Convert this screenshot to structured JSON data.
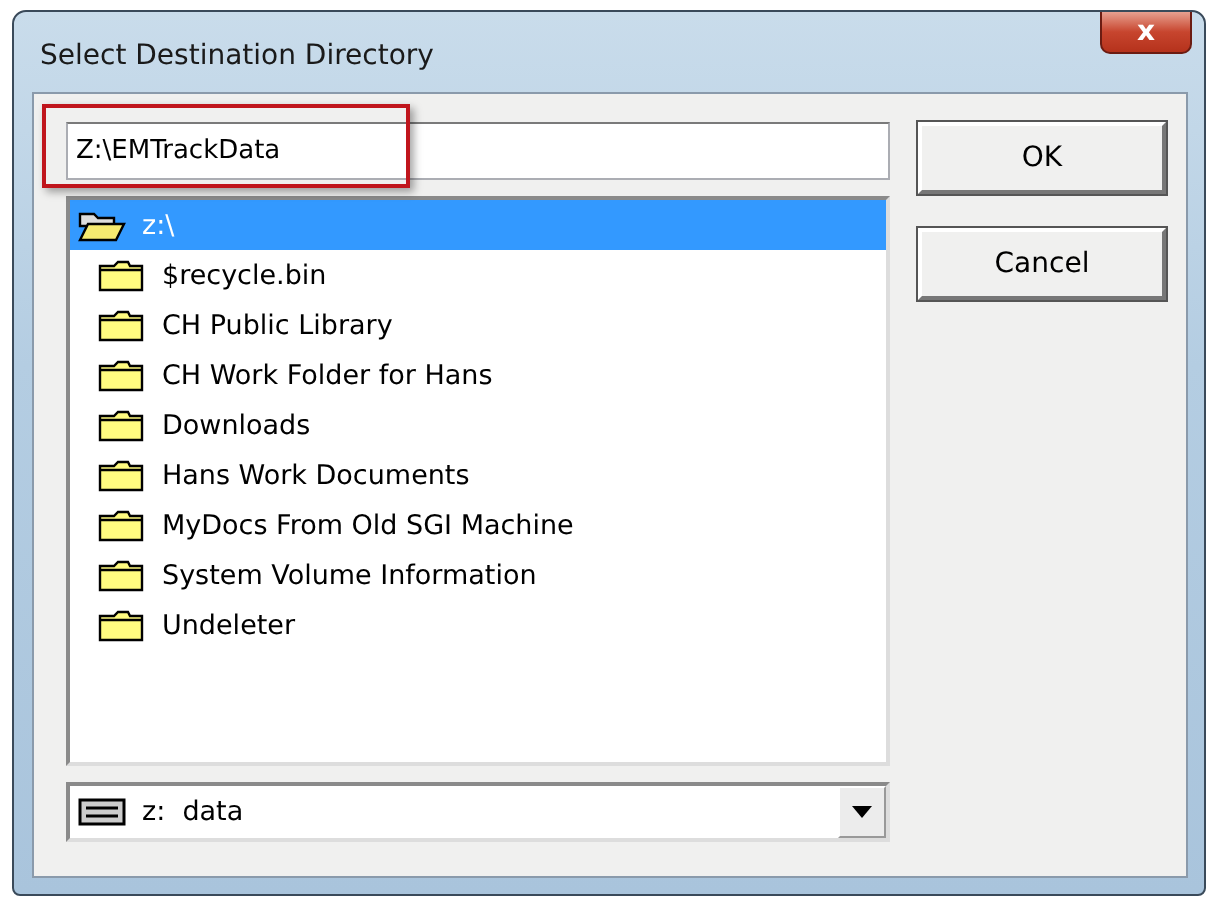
{
  "window": {
    "title": "Select Destination Directory",
    "close_label": "x"
  },
  "path_field": {
    "value": "Z:\\EMTrackData"
  },
  "buttons": [
    "OK",
    "Cancel"
  ],
  "folders": [
    {
      "name": "z:\\",
      "kind": "open",
      "selected": true
    },
    {
      "name": "$recycle.bin",
      "kind": "closed",
      "selected": false
    },
    {
      "name": "CH Public Library",
      "kind": "closed",
      "selected": false
    },
    {
      "name": "CH Work Folder for Hans",
      "kind": "closed",
      "selected": false
    },
    {
      "name": "Downloads",
      "kind": "closed",
      "selected": false
    },
    {
      "name": "Hans Work Documents",
      "kind": "closed",
      "selected": false
    },
    {
      "name": "MyDocs From Old SGI Machine",
      "kind": "closed",
      "selected": false
    },
    {
      "name": "System Volume Information",
      "kind": "closed",
      "selected": false
    },
    {
      "name": "Undeleter",
      "kind": "closed",
      "selected": false
    }
  ],
  "drive_select": {
    "value": "z:  data"
  }
}
